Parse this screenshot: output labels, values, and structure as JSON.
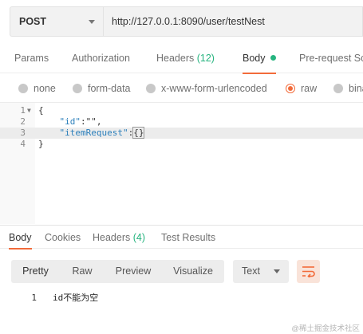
{
  "request": {
    "method": "POST",
    "url": "http://127.0.0.1:8090/user/testNest"
  },
  "request_tabs": [
    {
      "label": "Params"
    },
    {
      "label": "Authorization"
    },
    {
      "label": "Headers",
      "count": "(12)"
    },
    {
      "label": "Body"
    },
    {
      "label": "Pre-request Sc"
    }
  ],
  "body_types": [
    "none",
    "form-data",
    "x-www-form-urlencoded",
    "raw",
    "bina"
  ],
  "editor": {
    "line_numbers": [
      "1",
      "2",
      "3",
      "4"
    ],
    "lines": {
      "l1": "{",
      "l2_key": "\"id\"",
      "l2_rest": ":\"\",",
      "l3_key": "\"itemRequest\"",
      "l3_colon": ":",
      "l3_braces": "{}",
      "l4": "}"
    }
  },
  "response_tabs": [
    {
      "label": "Body"
    },
    {
      "label": "Cookies"
    },
    {
      "label": "Headers",
      "count": "(4)"
    },
    {
      "label": "Test Results"
    }
  ],
  "response_toolbar": {
    "views": [
      "Pretty",
      "Raw",
      "Preview",
      "Visualize"
    ],
    "format": "Text"
  },
  "response_body": {
    "line_number": "1",
    "text": "id不能为空"
  },
  "watermark": "@稀土掘金技术社区",
  "colors": {
    "accent": "#f26b3a",
    "count_green": "#26b47f",
    "json_key_blue": "#2b7fbb"
  }
}
